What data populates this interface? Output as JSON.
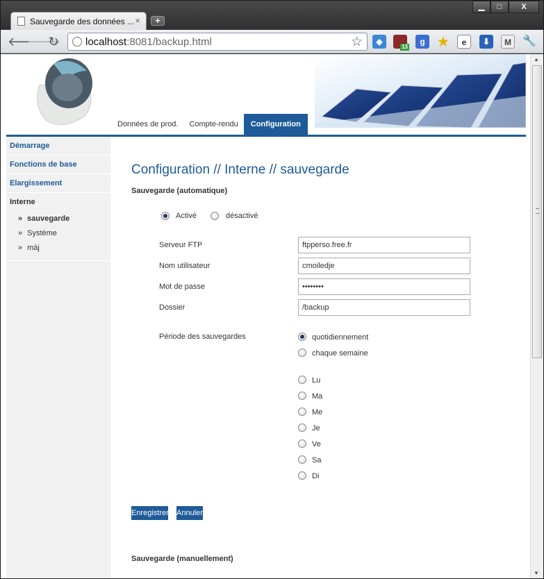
{
  "browser": {
    "tab_title": "Sauvegarde des données ...",
    "tab_close": "×",
    "new_tab": "+",
    "url_host": "localhost",
    "url_path": ":8081/backup.html",
    "controls": {
      "minimize": "▁",
      "maximize": "□",
      "close": "X"
    },
    "extensions": [
      "dropbox-icon",
      "gmail-counter-icon",
      "google-icon",
      "favorites-star-icon",
      "page-icon",
      "download-icon",
      "gmail-icon",
      "wrench-icon"
    ],
    "extension_badge": "13"
  },
  "topnav": [
    {
      "label": "Données de prod.",
      "active": false
    },
    {
      "label": "Compte-rendu",
      "active": false
    },
    {
      "label": "Configuration",
      "active": true
    }
  ],
  "sidebar": {
    "items": [
      {
        "label": "Démarrage"
      },
      {
        "label": "Fonctions de base"
      },
      {
        "label": "Elargissement"
      }
    ],
    "section": "Interne",
    "subitems": [
      {
        "label": "sauvegarde",
        "active": true
      },
      {
        "label": "Système",
        "active": false
      },
      {
        "label": "màj",
        "active": false
      }
    ],
    "bullet": "»"
  },
  "main": {
    "title": "Configuration // Interne // sauvegarde",
    "auto_section": "Sauvegarde (automatique)",
    "status_options": [
      {
        "label": "Activé",
        "checked": true
      },
      {
        "label": "désactivé",
        "checked": false
      }
    ],
    "fields": [
      {
        "label": "Serveur FTP",
        "value": "ftpperso.free.fr"
      },
      {
        "label": "Nom utilisateur",
        "value": "cmoiledje"
      },
      {
        "label": "Mot de passe",
        "value": "••••••••"
      },
      {
        "label": "Dossier",
        "value": "/backup"
      }
    ],
    "period_label": "Période des sauvegardes",
    "period_options": [
      {
        "label": "quotidiennement",
        "checked": true
      },
      {
        "label": "chaque semaine",
        "checked": false
      }
    ],
    "days": [
      "Lu",
      "Ma",
      "Me",
      "Je",
      "Ve",
      "Sa",
      "Di"
    ],
    "save_label": "Enregistrer",
    "cancel_label": "Annuler",
    "manual_section": "Sauvegarde (manuellement)"
  },
  "colors": {
    "accent": "#1e5b98",
    "sidebar_bg": "#f1f1f1"
  }
}
